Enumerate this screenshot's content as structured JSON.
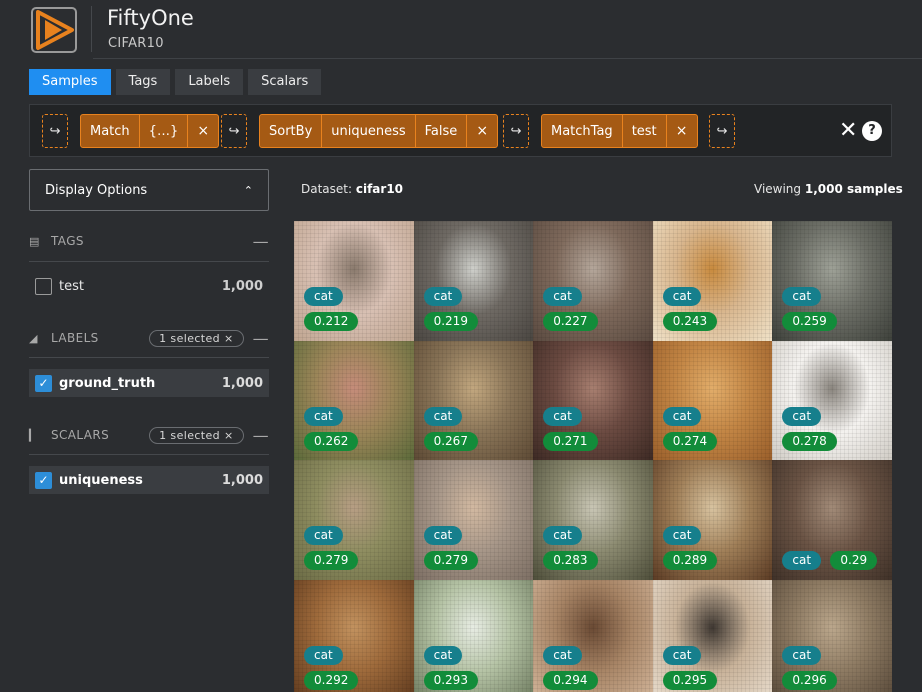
{
  "header": {
    "title": "FiftyOne",
    "subtitle": "CIFAR10"
  },
  "tabs": [
    {
      "label": "Samples",
      "active": true
    },
    {
      "label": "Tags",
      "active": false
    },
    {
      "label": "Labels",
      "active": false
    },
    {
      "label": "Scalars",
      "active": false
    }
  ],
  "stages": {
    "add_glyph": "↪",
    "close_glyph": "×",
    "match": {
      "name": "Match",
      "arg": "{…}"
    },
    "sortby": {
      "name": "SortBy",
      "field": "uniqueness",
      "reverse": "False"
    },
    "matchtag": {
      "name": "MatchTag",
      "tag": "test"
    },
    "clear_glyph": "✕",
    "help_glyph": "?"
  },
  "sidebar": {
    "display_options": "Display Options",
    "tags": {
      "title": "TAGS",
      "items": [
        {
          "label": "test",
          "count": "1,000",
          "checked": false
        }
      ]
    },
    "labels": {
      "title": "LABELS",
      "selected": "1 selected ×",
      "items": [
        {
          "label": "ground_truth",
          "count": "1,000",
          "checked": true
        }
      ]
    },
    "scalars": {
      "title": "SCALARS",
      "selected": "1 selected ×",
      "items": [
        {
          "label": "uniqueness",
          "count": "1,000",
          "checked": true
        }
      ]
    }
  },
  "main": {
    "dataset_prefix": "Dataset: ",
    "dataset_name": "cifar10",
    "viewing_prefix": "Viewing ",
    "viewing_count": "1,000 samples"
  },
  "samples": [
    {
      "label": "cat",
      "uniqueness": "0.212",
      "colors": [
        "#d8c0b3",
        "#8a7a6d",
        "#bfa590"
      ]
    },
    {
      "label": "cat",
      "uniqueness": "0.219",
      "colors": [
        "#6f6a64",
        "#cfd0cb",
        "#4a4641"
      ]
    },
    {
      "label": "cat",
      "uniqueness": "0.227",
      "colors": [
        "#7f6a5c",
        "#b5a79b",
        "#5a4a40"
      ]
    },
    {
      "label": "cat",
      "uniqueness": "0.243",
      "colors": [
        "#d9b78f",
        "#c88a3e",
        "#f0e2c8"
      ]
    },
    {
      "label": "cat",
      "uniqueness": "0.259",
      "colors": [
        "#6c6e66",
        "#9ea197",
        "#3e413b"
      ]
    },
    {
      "label": "cat",
      "uniqueness": "0.262",
      "colors": [
        "#9c8659",
        "#c58c7a",
        "#5b6a3a"
      ]
    },
    {
      "label": "cat",
      "uniqueness": "0.267",
      "colors": [
        "#8a7558",
        "#c2a77f",
        "#5d4a35"
      ]
    },
    {
      "label": "cat",
      "uniqueness": "0.271",
      "colors": [
        "#6c4b42",
        "#a87f70",
        "#3d2a24"
      ]
    },
    {
      "label": "cat",
      "uniqueness": "0.274",
      "colors": [
        "#c38645",
        "#e2ad6a",
        "#9a5f2b"
      ]
    },
    {
      "label": "cat",
      "uniqueness": "0.278",
      "colors": [
        "#f4f2ef",
        "#8a857e",
        "#d0ccc5"
      ]
    },
    {
      "label": "cat",
      "uniqueness": "0.279",
      "colors": [
        "#8e8d60",
        "#b79e84",
        "#6b6b45"
      ]
    },
    {
      "label": "cat",
      "uniqueness": "0.279",
      "colors": [
        "#a69688",
        "#d2b9a1",
        "#7c6e63"
      ]
    },
    {
      "label": "cat",
      "uniqueness": "0.283",
      "colors": [
        "#8b8a70",
        "#c9c6b5",
        "#4e4e3a"
      ]
    },
    {
      "label": "cat",
      "uniqueness": "0.289",
      "colors": [
        "#a07f58",
        "#d8c3a0",
        "#5b3b24"
      ]
    },
    {
      "label": "cat",
      "uniqueness": "0.29",
      "colors": [
        "#6b5445",
        "#a28b78",
        "#3f3128"
      ]
    },
    {
      "label": "cat",
      "uniqueness": "0.292",
      "colors": [
        "#9e6a3b",
        "#c2925f",
        "#5f3a1e"
      ]
    },
    {
      "label": "cat",
      "uniqueness": "0.293",
      "colors": [
        "#b5c3a5",
        "#e7ece3",
        "#6f7c60"
      ]
    },
    {
      "label": "cat",
      "uniqueness": "0.294",
      "colors": [
        "#a88566",
        "#6a4a34",
        "#d2b59a"
      ]
    },
    {
      "label": "cat",
      "uniqueness": "0.295",
      "colors": [
        "#c9b39a",
        "#3f3832",
        "#e8dccd"
      ]
    },
    {
      "label": "cat",
      "uniqueness": "0.296",
      "colors": [
        "#8e7b63",
        "#bba78c",
        "#594a3a"
      ]
    }
  ]
}
